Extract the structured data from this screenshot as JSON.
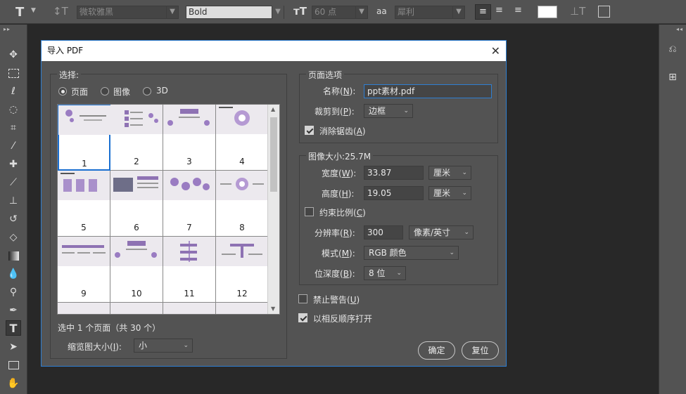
{
  "toolbar": {
    "font_family": "微软雅黑",
    "font_style": "Bold",
    "font_size": "60 点",
    "antialias": "犀利",
    "aa_glyph": "a"
  },
  "dialog": {
    "title": "导入 PDF",
    "select_group": {
      "label": "选择:",
      "options": [
        "页面",
        "图像",
        "3D"
      ],
      "selected": "页面"
    },
    "thumbnails": [
      "1",
      "2",
      "3",
      "4",
      "5",
      "6",
      "7",
      "8",
      "9",
      "10",
      "11",
      "12"
    ],
    "selection_status": "选中 1 个页面（共 30 个）",
    "thumb_size_label": "缩览图大小(",
    "thumb_size_key": "I",
    "thumb_size_suffix": "):",
    "thumb_size_value": "小",
    "page_options": {
      "label": "页面选项",
      "name_label": "名称(",
      "name_key": "N",
      "name_suffix": "):",
      "name_value": "ppt素材.pdf",
      "crop_label": "裁剪到(",
      "crop_key": "P",
      "crop_suffix": "):",
      "crop_value": "边框",
      "antialias_label": "消除锯齿(",
      "antialias_key": "A",
      "antialias_suffix": ")",
      "antialias_checked": true
    },
    "image_size": {
      "label": "图像大小:25.7M",
      "width_label": "宽度(",
      "width_key": "W",
      "width_suffix": "):",
      "width_value": "33.87",
      "width_unit": "厘米",
      "height_label": "高度(",
      "height_key": "H",
      "height_suffix": "):",
      "height_value": "19.05",
      "height_unit": "厘米",
      "constrain_label": "约束比例(",
      "constrain_key": "C",
      "constrain_suffix": ")",
      "constrain_checked": false,
      "resolution_label": "分辨率(",
      "resolution_key": "R",
      "resolution_suffix": "):",
      "resolution_value": "300",
      "resolution_unit": "像素/英寸",
      "mode_label": "模式(",
      "mode_key": "M",
      "mode_suffix": "):",
      "mode_value": "RGB 颜色",
      "depth_label": "位深度(",
      "depth_key": "B",
      "depth_suffix": "):",
      "depth_value": "8 位"
    },
    "suppress_warnings_label": "禁止警告(",
    "suppress_warnings_key": "U",
    "suppress_warnings_suffix": ")",
    "suppress_checked": false,
    "reverse_order_label": "以相反顺序打开",
    "reverse_checked": true,
    "ok_label": "确定",
    "reset_label": "复位"
  }
}
